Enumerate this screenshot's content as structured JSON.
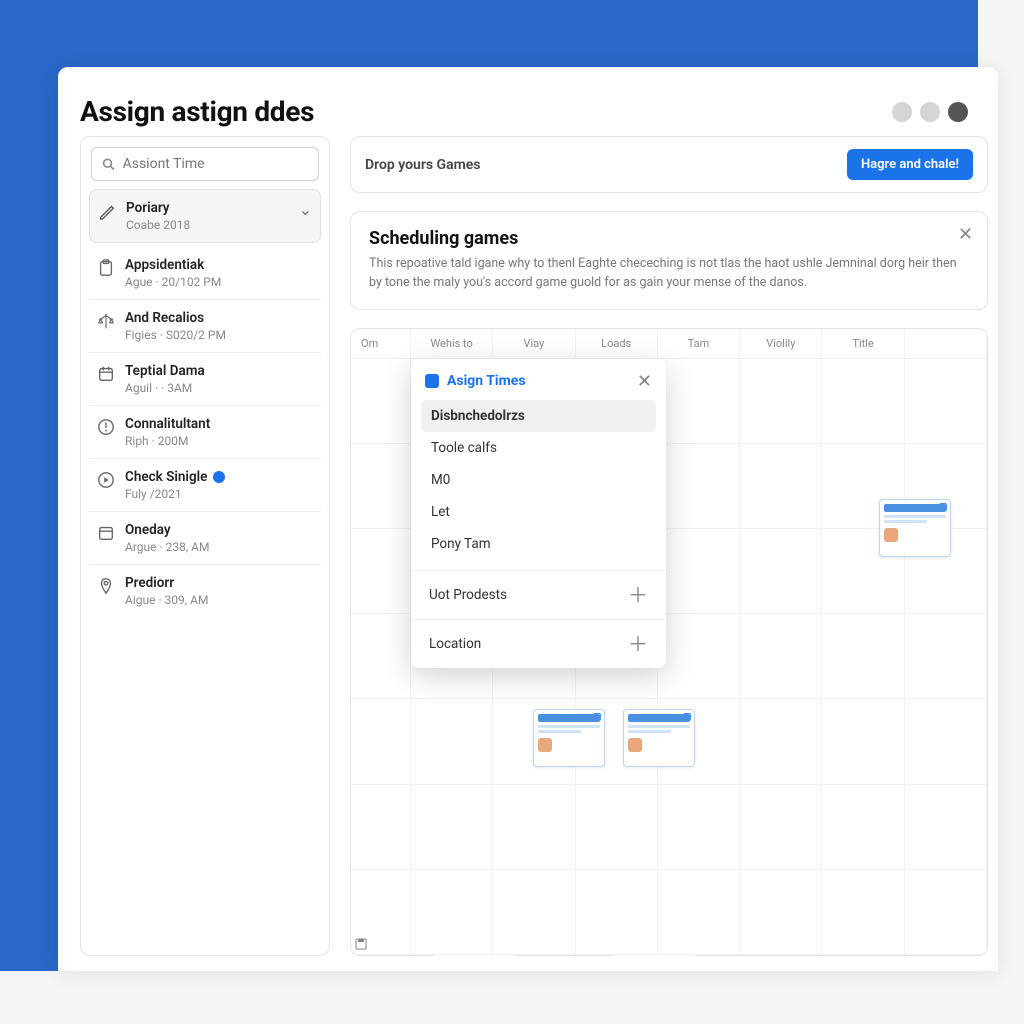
{
  "header": {
    "title": "Assign astign ddes"
  },
  "search": {
    "placeholder": "Assiont Time"
  },
  "sidebar": {
    "items": [
      {
        "title": "Poriary",
        "sub": "Coabe 2018"
      },
      {
        "title": "Appsidentiak",
        "sub": "Ague · 20/102 PM"
      },
      {
        "title": "And Recalios",
        "sub": "Figies · S020/2 PM"
      },
      {
        "title": "Teptial Dama",
        "sub": "Aguil · · 3AM"
      },
      {
        "title": "Connalitultant",
        "sub": "Riph · 200M"
      },
      {
        "title": "Check Sinigle",
        "sub": "Fuly /2021"
      },
      {
        "title": "Oneday",
        "sub": "Argue · 238, AM"
      },
      {
        "title": "Prediorr",
        "sub": "Aigue · 309, AM"
      }
    ]
  },
  "topbar": {
    "left": "Drop yours Games",
    "button": "Hagre and chale!"
  },
  "info": {
    "title": "Scheduling games",
    "body": "This repoative tald igane why to thenl Eaghte checeching is not tlas the haot ushle Jemninal dorg heir then by tone the maly you's accord game guold for as gain your mense of the danos."
  },
  "calendar": {
    "head": [
      "Om",
      "Wehis to",
      "Viay",
      "Loads",
      "Tam",
      "Violily",
      "Title"
    ]
  },
  "popup": {
    "title": "Asign Times",
    "options": [
      "Disbnchedolrzs",
      "Toole calfs",
      "M0",
      "Let",
      "Pony Tam"
    ],
    "rows": [
      "Uot Prodests",
      "Location"
    ]
  }
}
